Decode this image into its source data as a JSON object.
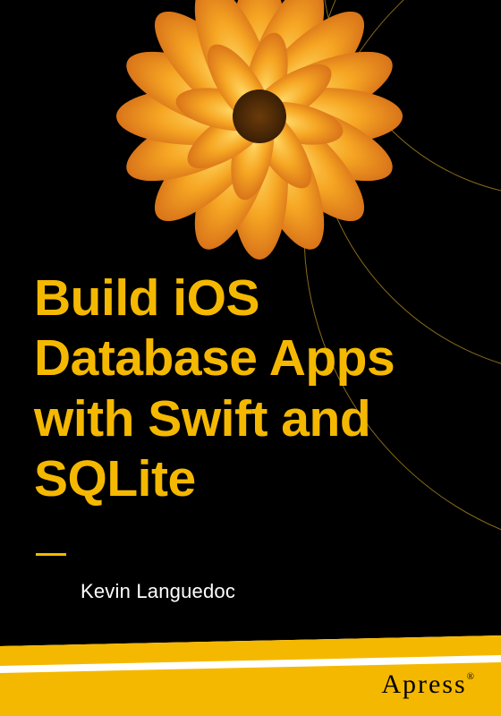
{
  "title": "Build iOS Database Apps with Swift and SQLite",
  "author": "Kevin Languedoc",
  "publisher": "Apress",
  "colors": {
    "accent": "#f5b800",
    "background": "#000000",
    "text_light": "#ffffff"
  },
  "decor": {
    "flower_icon": "dahlia-flower",
    "arc_icon": "decorative-arcs"
  }
}
